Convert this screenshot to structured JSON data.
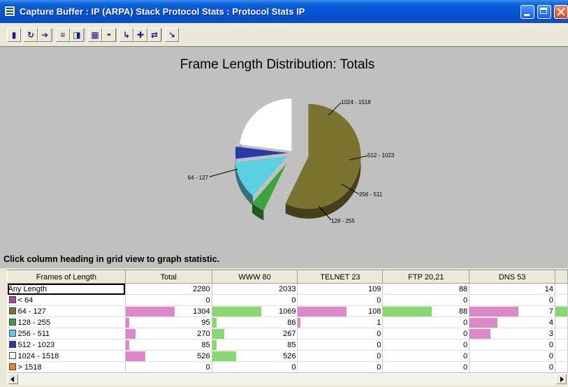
{
  "window": {
    "title": "Capture Buffer : IP (ARPA) Stack Protocol Stats : Protocol Stats IP"
  },
  "toolbar": {
    "buttons": [
      {
        "name": "stop-icon",
        "glyph": "▮"
      },
      {
        "name": "refresh-icon",
        "glyph": "↻"
      },
      {
        "name": "go-arrow-icon",
        "glyph": "➔"
      },
      {
        "name": "sort-az-icon",
        "glyph": "≡"
      },
      {
        "name": "chart-view-icon",
        "glyph": "◨"
      },
      {
        "name": "grid-view-icon",
        "glyph": "▦"
      },
      {
        "name": "pie-chart-icon",
        "glyph": "◓"
      },
      {
        "name": "zoom-icon",
        "glyph": "↳"
      },
      {
        "name": "add-icon",
        "glyph": "✚"
      },
      {
        "name": "network-icon",
        "glyph": "⇄"
      },
      {
        "name": "pointer-icon",
        "glyph": "↘"
      }
    ]
  },
  "chart_data": {
    "type": "pie",
    "title": "Frame Length Distribution: Totals",
    "labels": [
      "< 64",
      "64 - 127",
      "128 - 255",
      "256 - 511",
      "512 - 1023",
      "1024 - 1518",
      "> 1518"
    ],
    "values": [
      0,
      1304,
      95,
      270,
      85,
      526,
      0
    ],
    "colors": [
      "#c0409a",
      "#7a7430",
      "#3aa33a",
      "#5ccfe0",
      "#2a3aa8",
      "#ffffff",
      "#f08020"
    ],
    "exploded": true,
    "style": "3d"
  },
  "hint": "Click column heading in grid view to graph statistic.",
  "grid": {
    "columns": [
      "Frames of Length",
      "Total",
      "WWW 80",
      "TELNET 23",
      "FTP 20,21",
      "DNS 53"
    ],
    "rows": [
      {
        "label": "Any Length",
        "swatch": "",
        "values": [
          "2280",
          "2033",
          "109",
          "88",
          "14"
        ]
      },
      {
        "label": "< 64",
        "swatch": "#c0409a",
        "values": [
          "0",
          "0",
          "0",
          "0",
          "0"
        ]
      },
      {
        "label": "64 - 127",
        "swatch": "#7a7430",
        "values": [
          "1304",
          "1069",
          "108",
          "88",
          "7"
        ]
      },
      {
        "label": "128 - 255",
        "swatch": "#3aa33a",
        "values": [
          "95",
          "86",
          "1",
          "0",
          "4"
        ]
      },
      {
        "label": "256 - 511",
        "swatch": "#5ccfe0",
        "values": [
          "270",
          "267",
          "0",
          "0",
          "3"
        ]
      },
      {
        "label": "512 - 1023",
        "swatch": "#2a3aa8",
        "values": [
          "85",
          "85",
          "0",
          "0",
          "0"
        ]
      },
      {
        "label": "1024 - 1518",
        "swatch": "#ffffff",
        "values": [
          "526",
          "526",
          "0",
          "0",
          "0"
        ]
      },
      {
        "label": "> 1518",
        "swatch": "#f08020",
        "values": [
          "0",
          "0",
          "0",
          "0",
          "0"
        ]
      }
    ],
    "bar_colors": {
      "pink": "#dd88c8",
      "green": "#88d870"
    }
  }
}
